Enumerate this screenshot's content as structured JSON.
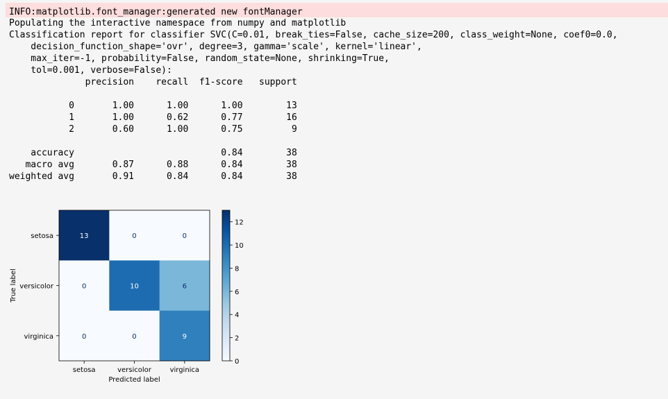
{
  "stderr": {
    "line": "INFO:matplotlib.font_manager:generated new fontManager"
  },
  "stdout_lines": [
    "Populating the interactive namespace from numpy and matplotlib",
    "Classification report for classifier SVC(C=0.01, break_ties=False, cache_size=200, class_weight=None, coef0=0.0,",
    "    decision_function_shape='ovr', degree=3, gamma='scale', kernel='linear',",
    "    max_iter=-1, probability=False, random_state=None, shrinking=True,",
    "    tol=0.001, verbose=False):",
    "              precision    recall  f1-score   support",
    "",
    "           0       1.00      1.00      1.00        13",
    "           1       1.00      0.62      0.77        16",
    "           2       0.60      1.00      0.75         9",
    "",
    "    accuracy                           0.84        38",
    "   macro avg       0.87      0.88      0.84        38",
    "weighted avg       0.91      0.84      0.84        38"
  ],
  "chart_data": {
    "type": "heatmap",
    "title": "",
    "xlabel": "Predicted label",
    "ylabel": "True label",
    "x_categories": [
      "setosa",
      "versicolor",
      "virginica"
    ],
    "y_categories": [
      "setosa",
      "versicolor",
      "virginica"
    ],
    "values": [
      [
        13,
        0,
        0
      ],
      [
        0,
        10,
        6
      ],
      [
        0,
        0,
        9
      ]
    ],
    "colormap": "Blues",
    "colorbar": {
      "range": [
        0,
        13
      ],
      "ticks": [
        0,
        2,
        4,
        6,
        8,
        10,
        12
      ]
    },
    "grid": false
  }
}
